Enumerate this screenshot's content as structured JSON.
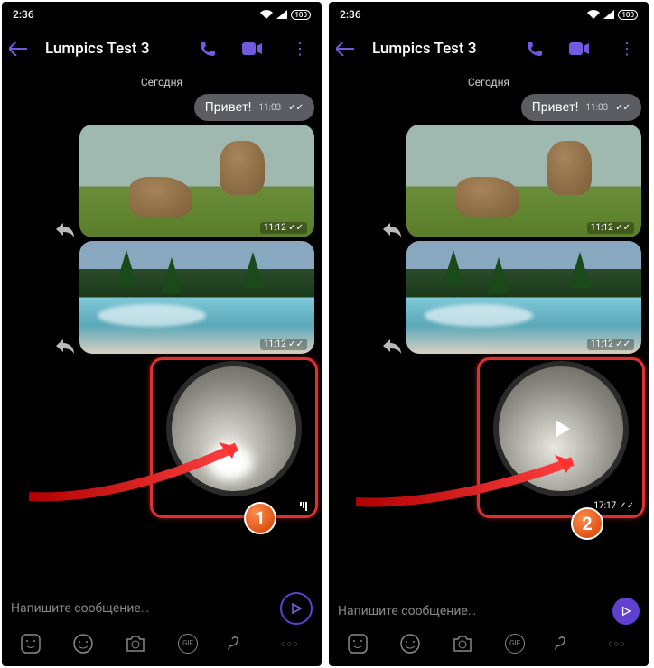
{
  "status": {
    "time": "2:36",
    "battery": "100"
  },
  "header": {
    "chat_title": "Lumpics Test 3"
  },
  "date_divider": "Сегодня",
  "messages": {
    "greeting": {
      "text": "Привет!",
      "time": "11:03"
    },
    "photo1": {
      "time": "11:12",
      "alt": "groundhogs-photo"
    },
    "photo2": {
      "time": "11:12",
      "alt": "river-forest-photo"
    }
  },
  "video": {
    "state_uploading": "uploading",
    "state_ready_time": "17:17"
  },
  "composer": {
    "placeholder": "Напишите сообщение…"
  },
  "markers": {
    "first": "1",
    "second": "2"
  },
  "icons": {
    "back": "←",
    "call": "phone",
    "video_call": "camera",
    "more": "⋮",
    "share": "↪",
    "sticker": "sticker",
    "smile": "smile",
    "camera": "camera",
    "gif": "GIF",
    "mic": "mic",
    "more_h": "•••",
    "send": "▷"
  },
  "colors": {
    "accent": "#7359de",
    "highlight": "#e03030",
    "marker": "#d04000"
  }
}
